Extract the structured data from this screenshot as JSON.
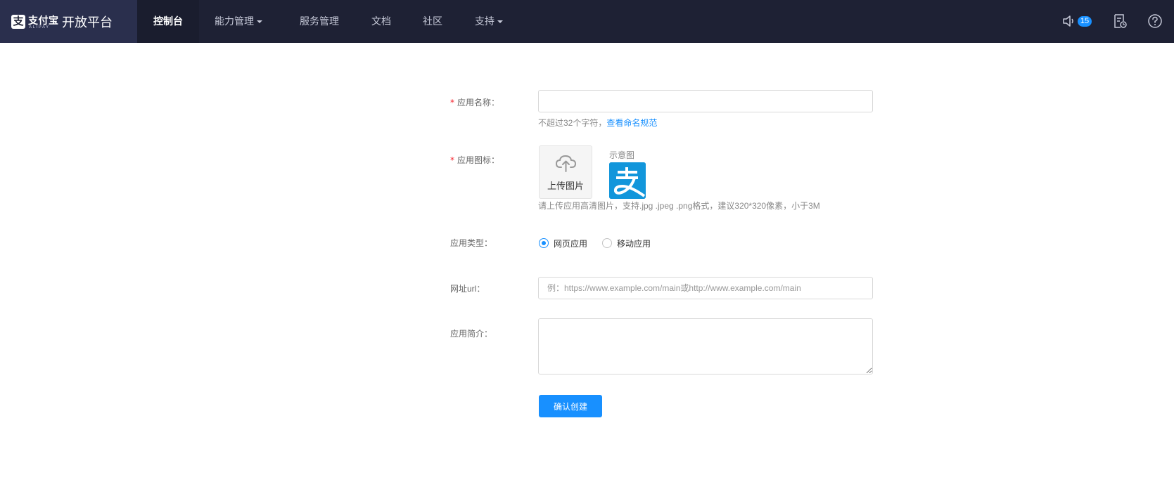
{
  "header": {
    "brand_cn": "支付宝",
    "brand_en": "ALIPAY",
    "platform_title": "开放平台",
    "nav": [
      {
        "label": "控制台",
        "active": true,
        "has_dropdown": false
      },
      {
        "label": "能力管理",
        "active": false,
        "has_dropdown": true
      },
      {
        "label": "服务管理",
        "active": false,
        "has_dropdown": false
      },
      {
        "label": "文档",
        "active": false,
        "has_dropdown": false
      },
      {
        "label": "社区",
        "active": false,
        "has_dropdown": false
      },
      {
        "label": "支持",
        "active": false,
        "has_dropdown": true
      }
    ],
    "icons": [
      "speaker-icon",
      "document-clock-icon",
      "help-icon"
    ],
    "notification_count": "15"
  },
  "form": {
    "app_name": {
      "label": "应用名称：",
      "required_mark": "*",
      "value": "",
      "hint": "不超过32个字符，",
      "hint_link": "查看命名规范"
    },
    "app_icon": {
      "label": "应用图标：",
      "required_mark": "*",
      "upload_label": "上传图片",
      "sample_label": "示意图",
      "sample_glyph": "支",
      "hint": "请上传应用高清图片，支持.jpg .jpeg .png格式，建议320*320像素，小于3M"
    },
    "app_type": {
      "label": "应用类型：",
      "options": [
        {
          "label": "网页应用",
          "checked": true
        },
        {
          "label": "移动应用",
          "checked": false
        }
      ]
    },
    "url": {
      "label": "网址url：",
      "value": "",
      "placeholder": "例：https://www.example.com/main或http://www.example.com/main"
    },
    "description": {
      "label": "应用简介：",
      "value": ""
    },
    "submit_label": "确认创建"
  },
  "colors": {
    "header_bg": "#1e2134",
    "brand_bg": "#2a2f4d",
    "accent": "#1890ff",
    "required": "#f5222d",
    "alipay_blue": "#1296db"
  }
}
